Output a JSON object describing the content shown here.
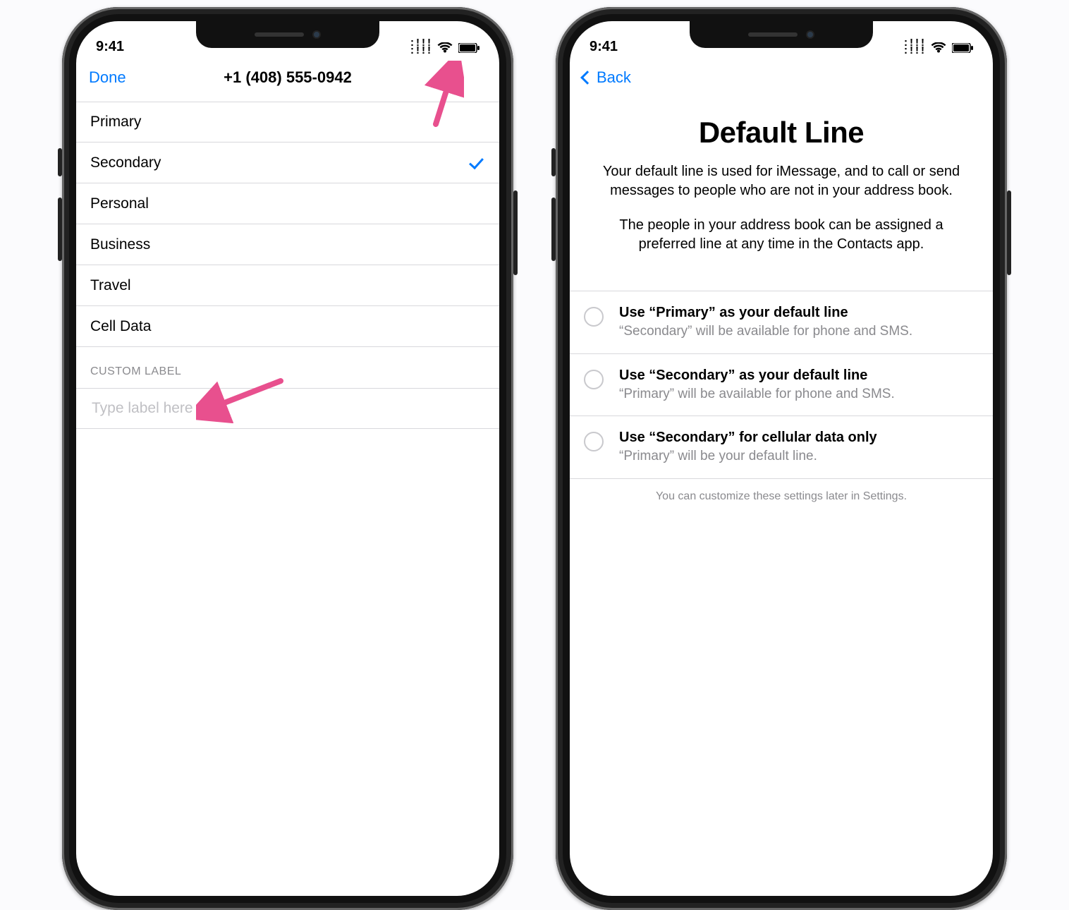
{
  "status": {
    "time": "9:41",
    "signal_glyph": ":!!!"
  },
  "screen1": {
    "nav": {
      "left": "Done",
      "title": "+1 (408) 555-0942"
    },
    "labels": [
      "Primary",
      "Secondary",
      "Personal",
      "Business",
      "Travel",
      "Cell Data"
    ],
    "selected_index": 1,
    "custom_section": "Custom Label",
    "custom_placeholder": "Type label here"
  },
  "screen2": {
    "nav": {
      "back": "Back"
    },
    "title": "Default Line",
    "para1": "Your default line is used for iMessage, and to call or send messages to people who are not in your address book.",
    "para2": "The people in your address book can be assigned a preferred line at any time in the Contacts app.",
    "options": [
      {
        "title": "Use “Primary” as your default line",
        "sub": "“Secondary” will be available for phone and SMS."
      },
      {
        "title": "Use “Secondary” as your default line",
        "sub": "“Primary” will be available for phone and SMS."
      },
      {
        "title": "Use “Secondary” for cellular data only",
        "sub": "“Primary” will be your default line."
      }
    ],
    "footnote": "You can customize these settings later in Settings."
  }
}
